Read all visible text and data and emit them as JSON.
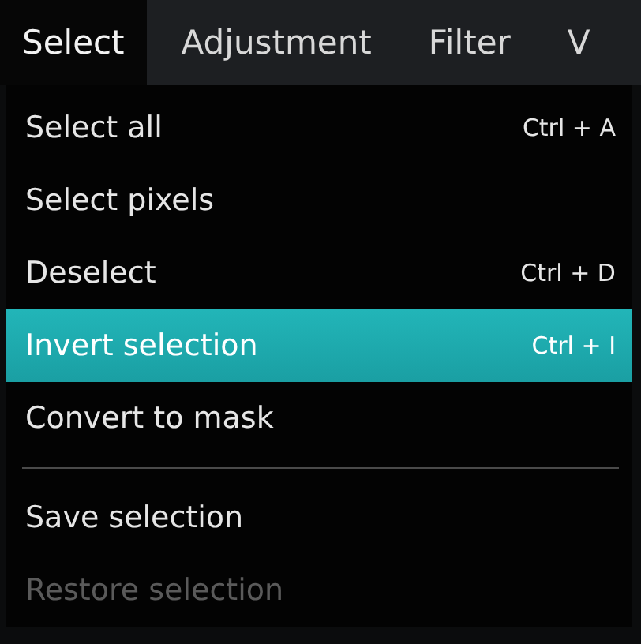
{
  "menubar": [
    {
      "label": "Select",
      "selected": true
    },
    {
      "label": "Adjustment",
      "selected": false
    },
    {
      "label": "Filter",
      "selected": false
    },
    {
      "label": "V",
      "selected": false
    }
  ],
  "menu": [
    {
      "kind": "item",
      "label": "Select all",
      "shortcut": "Ctrl + A",
      "selected": false,
      "disabled": false
    },
    {
      "kind": "item",
      "label": "Select pixels",
      "selected": false,
      "disabled": false
    },
    {
      "kind": "item",
      "label": "Deselect",
      "shortcut": "Ctrl + D",
      "selected": false,
      "disabled": false
    },
    {
      "kind": "item",
      "label": "Invert selection",
      "shortcut": "Ctrl + I",
      "selected": true,
      "disabled": false
    },
    {
      "kind": "item",
      "label": "Convert to mask",
      "selected": false,
      "disabled": false
    },
    {
      "kind": "separator"
    },
    {
      "kind": "item",
      "label": "Save selection",
      "selected": false,
      "disabled": false
    },
    {
      "kind": "item",
      "label": "Restore selection",
      "selected": false,
      "disabled": true
    }
  ]
}
